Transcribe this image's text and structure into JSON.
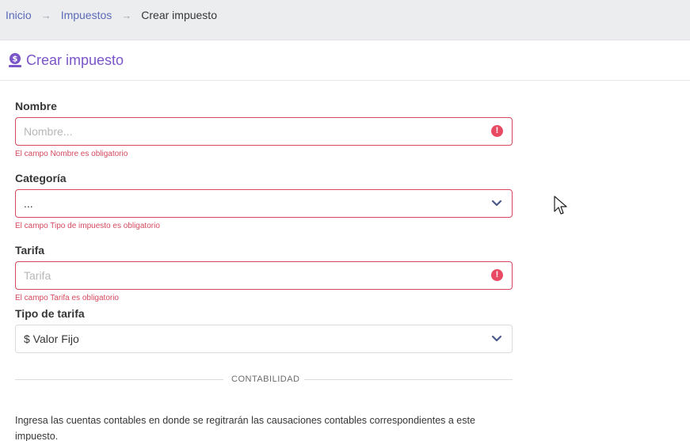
{
  "breadcrumb": {
    "items": [
      "Inicio",
      "Impuestos"
    ],
    "separator": "→",
    "current": "Crear impuesto"
  },
  "page": {
    "title": "Crear impuesto",
    "title_icon": "money-hand-icon"
  },
  "form": {
    "nombre": {
      "label": "Nombre",
      "placeholder": "Nombre...",
      "value": "",
      "error": "El campo Nombre es obligatorio"
    },
    "categoria": {
      "label": "Categoría",
      "selected": "...",
      "error": "El campo Tipo de impuesto es obligatorio"
    },
    "tarifa": {
      "label": "Tarifa",
      "placeholder": "Tarifa",
      "value": "",
      "error": "El campo Tarifa es obligatorio"
    },
    "tipo_tarifa": {
      "label": "Tipo de tarifa",
      "selected": "$ Valor Fijo"
    }
  },
  "section": {
    "divider_label": "CONTABILIDAD",
    "description": "Ingresa las cuentas contables en donde se regitrarán las causaciones contables correspondientes a este impuesto."
  },
  "colors": {
    "accent": "#7a55c9",
    "link": "#5a6ab8",
    "error": "#d6495e",
    "breadcrumb_bg": "#ecedef"
  }
}
